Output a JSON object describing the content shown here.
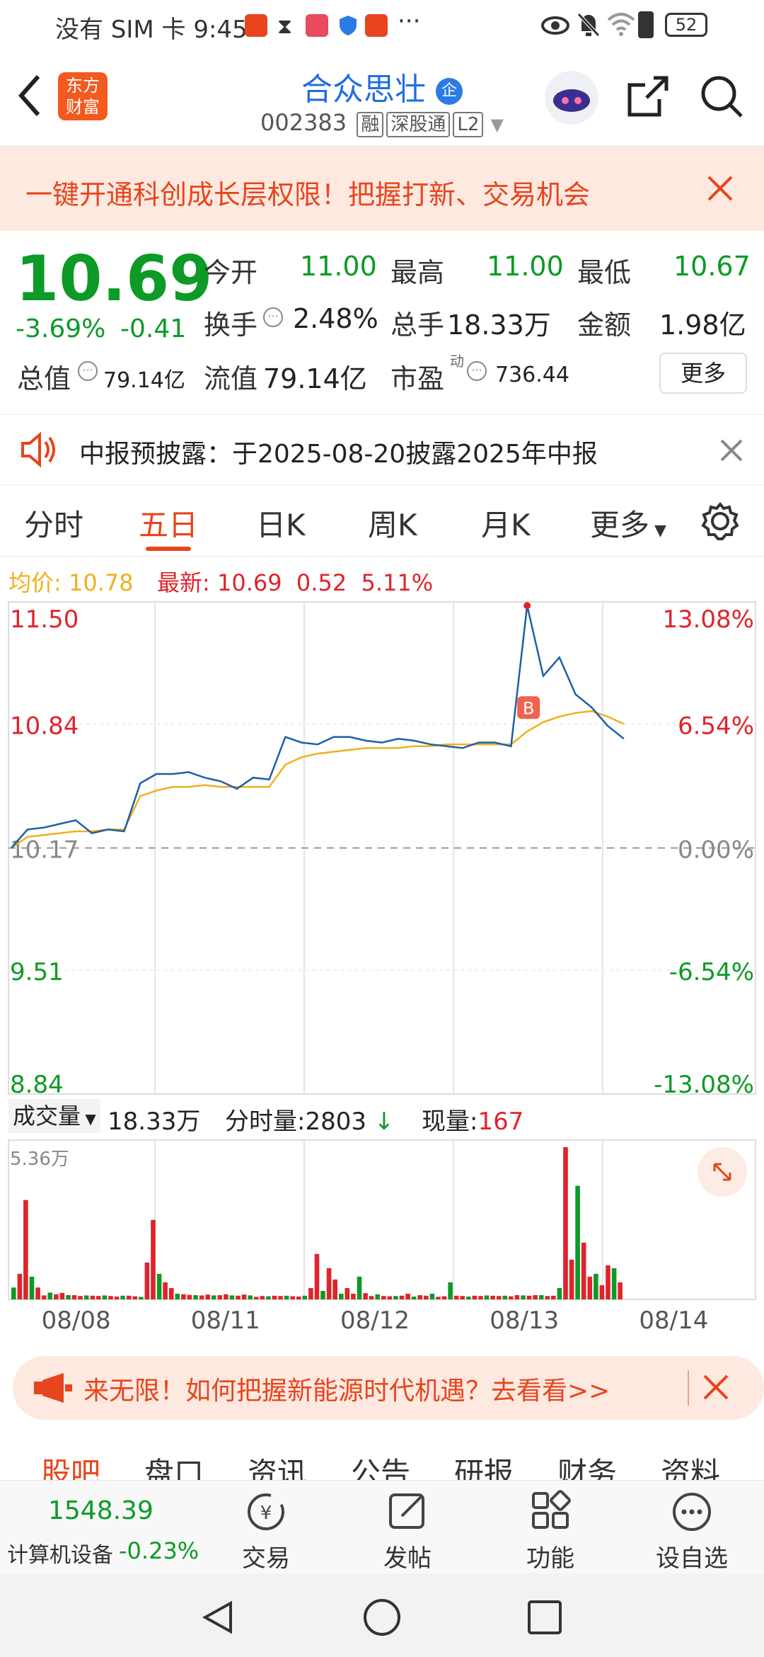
{
  "status_bar": {
    "carrier": "没有 SIM 卡",
    "time": "9:45",
    "dots": "···",
    "battery": "52"
  },
  "header": {
    "logo_text_1": "东方",
    "logo_text_2": "财富",
    "stock_name": "合众思壮",
    "badge": "企",
    "code": "002383",
    "tags": [
      "融",
      "深股通",
      "L2"
    ]
  },
  "banner": {
    "text": "一键开通科创成长层权限！把握打新、交易机会"
  },
  "quote": {
    "price": "10.69",
    "change_pct": "-3.69%",
    "change": "-0.41",
    "open_label": "今开",
    "open": "11.00",
    "high_label": "最高",
    "high": "11.00",
    "low_label": "最低",
    "low": "10.67",
    "turnover_label": "换手",
    "turnover": "2.48%",
    "volume_label": "总手",
    "volume": "18.33万",
    "amount_label": "金额",
    "amount": "1.98亿",
    "mktcap_label": "总值",
    "mktcap": "79.14亿",
    "float_label": "流值",
    "float": "79.14亿",
    "pe_label": "市盈",
    "pe_sup": "动",
    "pe": "736.44",
    "more_label": "更多"
  },
  "notice": {
    "text": "中报预披露：于2025-08-20披露2025年中报"
  },
  "tabs": [
    "分时",
    "五日",
    "日K",
    "周K",
    "月K",
    "更多"
  ],
  "active_tab": "五日",
  "chart_info": {
    "avg_label": "均价:",
    "avg": "10.78",
    "latest_label": "最新:",
    "latest": "10.69",
    "diff": "0.52",
    "pct": "5.11%",
    "b_marker": "B"
  },
  "volume_info": {
    "selector": "成交量",
    "total": "18.33万",
    "min_label": "分时量:",
    "min_value": "2803",
    "now_label": "现量:",
    "now_value": "167",
    "max_label": "5.36万"
  },
  "chart_data": {
    "type": "line",
    "title": "",
    "x_labels": [
      "08/08",
      "08/11",
      "08/12",
      "08/13",
      "08/14"
    ],
    "y_labels_left": [
      "11.50",
      "10.84",
      "10.17",
      "9.51",
      "8.84"
    ],
    "y_labels_right": [
      "13.08%",
      "6.54%",
      "0.00%",
      "-6.54%",
      "-13.08%"
    ],
    "ylim": [
      8.84,
      11.5
    ],
    "prev_close": 10.17,
    "series": [
      {
        "name": "",
        "values": [
          10.17,
          10.27,
          10.28,
          10.3,
          10.32,
          10.25,
          10.27,
          10.26,
          10.52,
          10.57,
          10.57,
          10.58,
          10.55,
          10.53,
          10.49,
          10.55,
          10.54,
          10.77,
          10.74,
          10.73,
          10.77,
          10.77,
          10.75,
          10.74,
          10.76,
          10.75,
          10.73,
          10.72,
          10.71,
          10.74,
          10.74,
          10.72,
          11.48,
          11.1,
          11.2,
          11.0,
          10.93,
          10.83,
          10.76
        ]
      },
      {
        "name": "",
        "values": [
          10.17,
          10.23,
          10.24,
          10.25,
          10.26,
          10.26,
          10.27,
          10.27,
          10.45,
          10.48,
          10.5,
          10.5,
          10.51,
          10.5,
          10.5,
          10.5,
          10.5,
          10.62,
          10.66,
          10.68,
          10.69,
          10.7,
          10.71,
          10.71,
          10.71,
          10.72,
          10.72,
          10.73,
          10.73,
          10.73,
          10.73,
          10.73,
          10.8,
          10.85,
          10.88,
          10.9,
          10.91,
          10.88,
          10.84
        ]
      }
    ],
    "grid": true,
    "legend": "none"
  },
  "volume_data": {
    "type": "bar",
    "max": 53600,
    "values": [
      4200,
      9000,
      35000,
      8000,
      4200,
      1400,
      2400,
      1800,
      2300,
      1500,
      1500,
      1200,
      1400,
      1300,
      1200,
      1400,
      1200,
      1000,
      1300,
      1300,
      1100,
      900,
      13000,
      28000,
      9000,
      6000,
      4000,
      2000,
      1800,
      1600,
      1500,
      1400,
      1700,
      1400,
      1500,
      1800,
      1400,
      1300,
      1700,
      1400,
      900,
      1200,
      1100,
      1300,
      1200,
      1300,
      1100,
      1000,
      1300,
      4000,
      16000,
      3000,
      11000,
      7000,
      2000,
      4000,
      2000,
      8000,
      2200,
      1200,
      1800,
      1200,
      1100,
      1200,
      1300,
      2000,
      1000,
      1500,
      1300,
      2000,
      900,
      1100,
      6000,
      1300,
      1200,
      1000,
      1300,
      1200,
      1400,
      1300,
      1200,
      1300,
      1100,
      1500,
      1400,
      1300,
      1500,
      1500,
      1200,
      1300,
      4000,
      53600,
      14000,
      40000,
      20000,
      8000,
      9000,
      5000,
      12000,
      11000,
      6000
    ]
  },
  "ad": {
    "text": "来无限！如何把握新能源时代机遇？去看看>>"
  },
  "sub_tabs": [
    "股吧",
    "盘口",
    "资讯",
    "公告",
    "研报",
    "财务",
    "资料"
  ],
  "bottom_bar": {
    "index_value": "1548.39",
    "index_name": "计算机设备",
    "index_change": "-0.23%",
    "items": [
      "交易",
      "发帖",
      "功能",
      "设自选"
    ]
  },
  "colors": {
    "accent": "#e8441d",
    "up": "#e0232b",
    "down": "#0d9a26",
    "price_line": "#1f5ea8",
    "avg_line": "#f0b01d",
    "link": "#1f6fe0"
  }
}
